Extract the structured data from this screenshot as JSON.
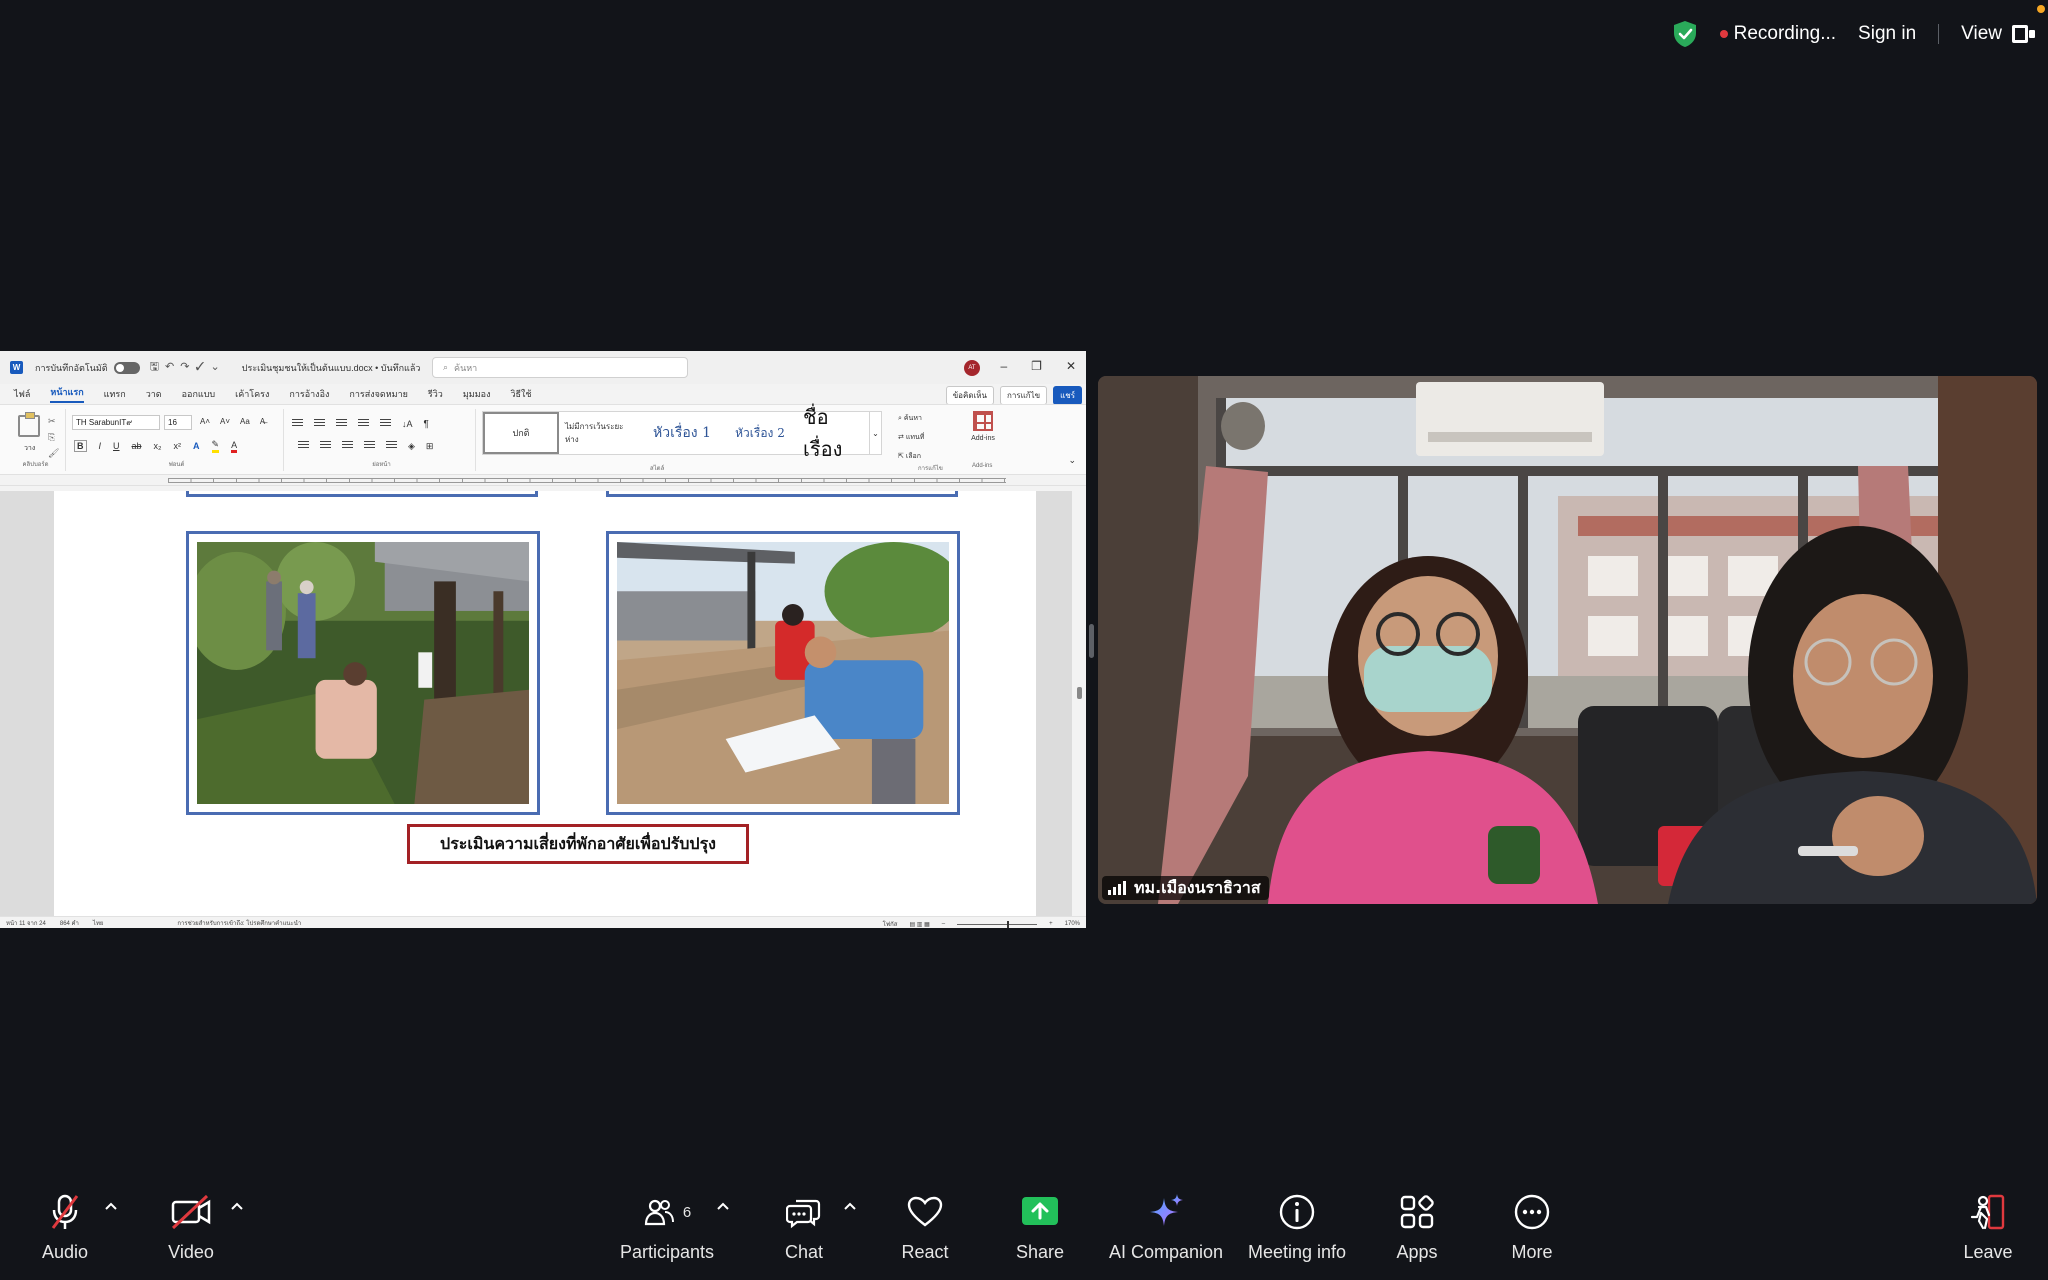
{
  "status_bar": {
    "recording": "Recording...",
    "sign_in": "Sign in",
    "view": "View"
  },
  "word": {
    "autosave_label": "การบันทึกอัตโนมัติ",
    "doc_title": "ประเมินชุมชนให้เป็นต้นแบบ.docx • บันทึกแล้ว",
    "search_placeholder": "ค้นหา",
    "avatar": "AT",
    "tabs": [
      "ไฟล์",
      "หน้าแรก",
      "แทรก",
      "วาด",
      "ออกแบบ",
      "เค้าโครง",
      "การอ้างอิง",
      "การส่งจดหมาย",
      "รีวิว",
      "มุมมอง",
      "วิธีใช้"
    ],
    "comments": "ข้อคิดเห็น",
    "editing": "การแก้ไข",
    "share": "แชร์",
    "font_name": "TH SarabunIT๙",
    "font_size": "16",
    "clipboard_label": "คลิปบอร์ด",
    "font_label": "ฟอนต์",
    "paragraph_label": "ย่อหน้า",
    "styles_label": "สไตล์",
    "editing_label": "การแก้ไข",
    "addins_label": "Add-ins",
    "paste_label": "วาง",
    "styles": [
      "ปกติ",
      "ไม่มีการเว้นระยะห่าง",
      "หัวเรื่อง 1",
      "หัวเรื่อง 2",
      "ชื่อเรื่อง"
    ],
    "find": "ค้นหา",
    "replace": "แทนที่",
    "select": "เลือก",
    "addins": "Add-ins",
    "caption": "ประเมินความเสี่ยงที่พักอาศัยเพื่อปรับปรุง",
    "status_page": "หน้า 11 จาก 24",
    "status_words": "864 คำ",
    "status_lang": "ไทย",
    "status_accessibility": "การช่วยสำหรับการเข้าถึง: โปรดศึกษาคำแนะนำ",
    "status_focus": "โฟกัส",
    "zoom": "170%"
  },
  "participant": {
    "name": "ทม.เมืองนราธิวาส"
  },
  "toolbar": {
    "audio": "Audio",
    "video": "Video",
    "participants": "Participants",
    "participants_count": "6",
    "chat": "Chat",
    "react": "React",
    "share": "Share",
    "ai_companion": "AI Companion",
    "meeting_info": "Meeting info",
    "apps": "Apps",
    "more": "More",
    "leave": "Leave"
  },
  "colors": {
    "background": "#121419",
    "recording_dot": "#e0393e",
    "shield": "#2aaa5a",
    "share_green": "#22c05a",
    "word_blue": "#185abd",
    "frame_blue": "#4a6cb2",
    "caption_border": "#a32125",
    "muted_red": "#e0393e"
  }
}
